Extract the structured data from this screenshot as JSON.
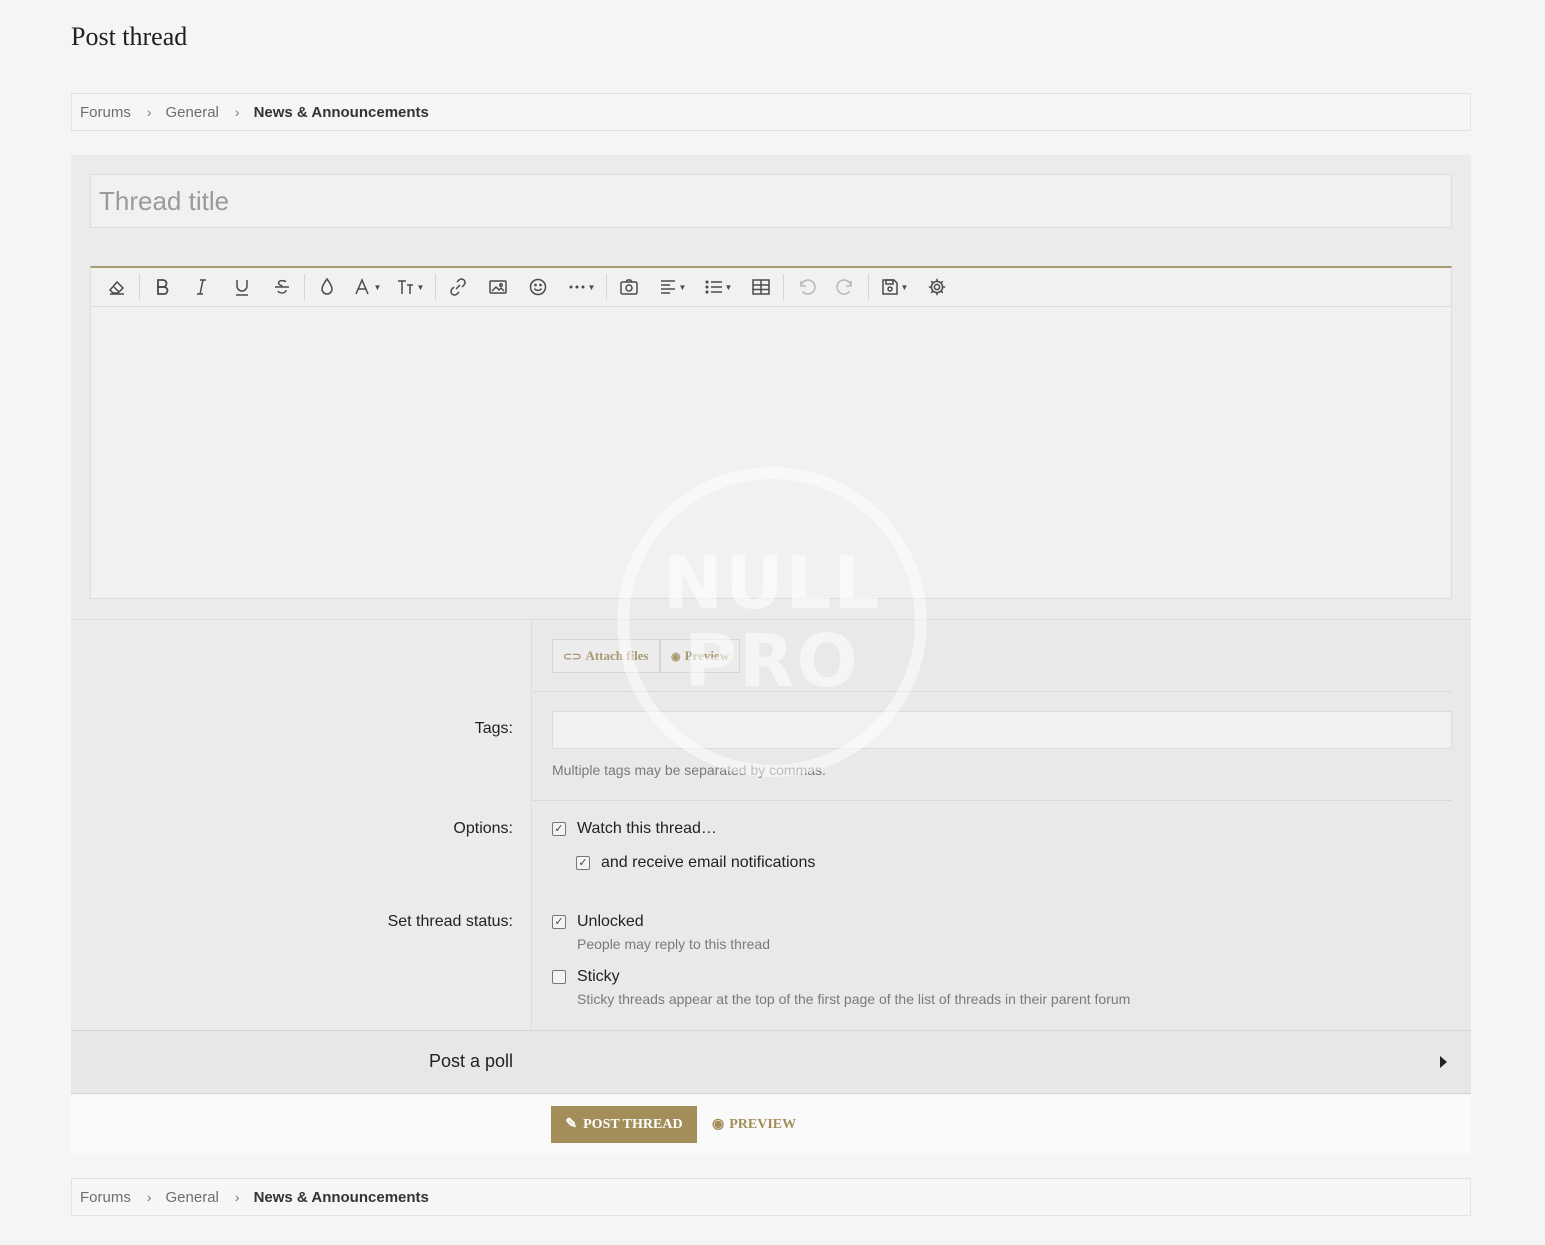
{
  "page": {
    "title": "Post thread"
  },
  "breadcrumb": {
    "items": [
      "Forums",
      "General",
      "News & Announcements"
    ],
    "separator": "›"
  },
  "thread_title": {
    "placeholder": "Thread title",
    "value": ""
  },
  "toolbar": {
    "accent_color": "#a79a73",
    "buttons": [
      "remove-format",
      "bold",
      "italic",
      "underline",
      "strikethrough",
      "text-color",
      "font-family",
      "font-size",
      "insert-link",
      "insert-image",
      "smilies",
      "more",
      "insert-media",
      "align",
      "list",
      "insert-table",
      "undo",
      "redo",
      "drafts",
      "toggle-bbcode"
    ]
  },
  "attachments": {
    "attach_label": "Attach files",
    "preview_label": "Preview"
  },
  "tags": {
    "label": "Tags:",
    "value": "",
    "hint": "Multiple tags may be separated by commas."
  },
  "options": {
    "label": "Options:",
    "watch_label": "Watch this thread…",
    "watch_checked": true,
    "email_label": "and receive email notifications",
    "email_checked": true
  },
  "status": {
    "label": "Set thread status:",
    "unlocked_label": "Unlocked",
    "unlocked_checked": true,
    "unlocked_hint": "People may reply to this thread",
    "sticky_label": "Sticky",
    "sticky_checked": false,
    "sticky_hint": "Sticky threads appear at the top of the first page of the list of threads in their parent forum"
  },
  "poll": {
    "label": "Post a poll"
  },
  "submit": {
    "post_label": "POST THREAD",
    "preview_label": "PREVIEW",
    "brand_color": "#a38e5a"
  },
  "watermark": {
    "line1": "NULL",
    "line2": "PRO"
  }
}
